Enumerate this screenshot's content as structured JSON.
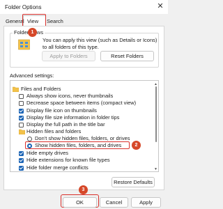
{
  "window": {
    "title": "Folder Options",
    "close_glyph": "✕"
  },
  "tabs": [
    {
      "label": "General"
    },
    {
      "label": "View"
    },
    {
      "label": "Search"
    }
  ],
  "active_tab": "View",
  "folder_views": {
    "group_label": "Folder views",
    "description": "You can apply this view (such as Details or Icons) to all folders of this type.",
    "apply_button": "Apply to Folders",
    "reset_button": "Reset Folders"
  },
  "advanced": {
    "label": "Advanced settings:",
    "items": [
      {
        "type": "folder",
        "label": "Files and Folders"
      },
      {
        "type": "checkbox",
        "checked": false,
        "label": "Always show icons, never thumbnails"
      },
      {
        "type": "checkbox",
        "checked": false,
        "label": "Decrease space between items (compact view)"
      },
      {
        "type": "checkbox",
        "checked": true,
        "label": "Display file icon on thumbnails"
      },
      {
        "type": "checkbox",
        "checked": true,
        "label": "Display file size information in folder tips"
      },
      {
        "type": "checkbox",
        "checked": false,
        "label": "Display the full path in the title bar"
      },
      {
        "type": "folder",
        "label": "Hidden files and folders"
      },
      {
        "type": "radio",
        "checked": false,
        "label": "Don't show hidden files, folders, or drives"
      },
      {
        "type": "radio",
        "checked": true,
        "label": "Show hidden files, folders, and drives"
      },
      {
        "type": "checkbox",
        "checked": true,
        "label": "Hide empty drives"
      },
      {
        "type": "checkbox",
        "checked": true,
        "label": "Hide extensions for known file types"
      },
      {
        "type": "checkbox",
        "checked": true,
        "label": "Hide folder merge conflicts"
      }
    ]
  },
  "restore_button": "Restore Defaults",
  "buttons": {
    "ok": "OK",
    "cancel": "Cancel",
    "apply": "Apply"
  },
  "step_badges": {
    "step1": "1",
    "step2": "2",
    "step3": "3"
  },
  "colors": {
    "accent": "#1b64b5",
    "annotation": "#d9302c",
    "badge": "#d64829"
  }
}
